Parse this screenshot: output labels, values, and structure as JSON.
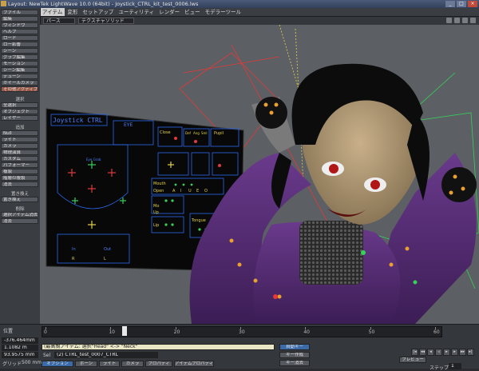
{
  "window": {
    "title": "Layout: NewTek LightWave 10.0 (64bit) - Joystick_CTRL_kit_test_0006.lws",
    "buttons": [
      "_",
      "□",
      "×"
    ]
  },
  "menubar": {
    "items": [
      "アイテム",
      "変形",
      "セットアップ",
      "ユーティリティ",
      "レンダー",
      "ビュー",
      "モデラーツール"
    ],
    "active_index": 0
  },
  "toolbar": {
    "view_mode": "パース",
    "shading": "テクスチャソリッド"
  },
  "left_panel": {
    "top_buttons": [
      "ファイル",
      "編集",
      "ウィンドウ",
      "ヘルプ",
      "ロード",
      "ロー影響",
      "シーン",
      "グラフ編集",
      "モーション",
      "シーン編集",
      "デューン",
      "ホイールカメラ"
    ],
    "highlight_button": "その他アクティブ",
    "sections": [
      {
        "header": "選択",
        "buttons": [
          "全選択",
          "オブジェクト",
          "レイヤー"
        ]
      },
      {
        "header": "追加",
        "buttons": [
          "Null",
          "ライト",
          "カメラ",
          "物理演算",
          "カスタム",
          "パフォーマー",
          "複製",
          "階層の複製",
          "消去"
        ]
      },
      {
        "header": "置き換え",
        "buttons": [
          "置き換え"
        ]
      },
      {
        "header": "削除",
        "buttons": [
          "選択アイテム消去",
          "消去"
        ]
      }
    ]
  },
  "viewport": {
    "panel_title": "Joystick CTRL",
    "panel_labels": [
      "EYE",
      "Close",
      "Def",
      "Ang",
      "Sml",
      "Pupil",
      "Mouth",
      "Open",
      "A",
      "I",
      "U",
      "E",
      "O",
      "Mo",
      "Up",
      "Lip",
      "Tongue",
      "In",
      "Out",
      "R",
      "L",
      "Eye Grab"
    ]
  },
  "timeline": {
    "ruler_numbers": [
      "0",
      "10",
      "20",
      "30",
      "40",
      "50",
      "60"
    ],
    "ruler_end": "60",
    "current_frame_fraction": 0.2,
    "position_label": "位置",
    "x_value": "-376.464mm",
    "y_value": "1.1082 m",
    "z_value": "93.9575 mm",
    "grid_label": "グリッド",
    "grid_value": "500 mm",
    "status_message": "(最高親アイテム: 選択\"Head\" <-> \"Neck\"",
    "current_item_label": "Sel",
    "current_item": "(2) CTRL_test_0007_CTRL",
    "buttons": {
      "auto_key": "自動キー",
      "create_key": "キー作成",
      "delete_key": "キー消去",
      "preview": "プレビュー",
      "step": "ステップ",
      "step_value": "1",
      "options": "オプション",
      "items": [
        "ボーン",
        "ライト",
        "カメラ",
        "プロパティ",
        "アイテムプロパティ"
      ]
    }
  },
  "colors": {
    "viewport_bg": "#5c5f63",
    "panel_line": "#2a6af0",
    "bone_green": "#36d25a",
    "bone_red": "#e23a3a",
    "yellow": "#e6d24a",
    "suit_purple": "#5b2d78"
  }
}
